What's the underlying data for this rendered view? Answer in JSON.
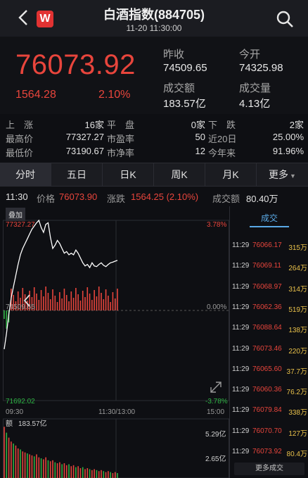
{
  "header": {
    "title": "白酒指数(884705)",
    "subtitle": "11-20 11:30:00",
    "logo_letter": "W"
  },
  "quote": {
    "price": "76073.92",
    "change": "1564.28",
    "change_pct": "2.10%",
    "prev_close_label": "昨收",
    "prev_close": "74509.65",
    "open_label": "今开",
    "open": "74325.98",
    "amount_label": "成交额",
    "amount": "183.57亿",
    "volume_label": "成交量",
    "volume": "4.13亿"
  },
  "stats": [
    [
      {
        "label": "上　涨",
        "value": "16家"
      },
      {
        "label": "平　盘",
        "value": "0家"
      },
      {
        "label": "下　跌",
        "value": "2家"
      }
    ],
    [
      {
        "label": "最高价",
        "value": "77327.27"
      },
      {
        "label": "市盈率",
        "value": "50"
      },
      {
        "label": "近20日",
        "value": "25.00%"
      }
    ],
    [
      {
        "label": "最低价",
        "value": "73190.67"
      },
      {
        "label": "市净率",
        "value": "12"
      },
      {
        "label": "今年来",
        "value": "91.96%"
      }
    ]
  ],
  "tabs": [
    "分时",
    "五日",
    "日K",
    "周K",
    "月K",
    "更多"
  ],
  "info": {
    "time": "11:30",
    "price_label": "价格",
    "price": "76073.90",
    "change_label": "涨跌",
    "change": "1564.25 (2.10%)",
    "amount_label": "成交额",
    "amount": "80.40万"
  },
  "chart": {
    "overlay_label": "叠加",
    "top_price": "77327.27",
    "top_pct": "3.78%",
    "mid_price": "74509.65",
    "mid_pct": "0.00%",
    "bottom_price": "71692.02",
    "bottom_pct": "-3.78%",
    "time_start": "09:30",
    "time_mid": "11:30/13:00",
    "time_end": "15:00",
    "volume_label": "额",
    "volume_total": "183.57亿",
    "vol_top": "5.29亿",
    "vol_mid": "2.65亿"
  },
  "chart_data": {
    "type": "line",
    "title": "白酒指数(884705)",
    "prev_close": 74509.65,
    "ylim": [
      71692.02,
      77327.27
    ],
    "x_labels": [
      "09:30",
      "11:30/13:00",
      "15:00"
    ],
    "price_series": [
      73300,
      73800,
      74400,
      74900,
      75250,
      75600,
      75950,
      76250,
      76450,
      76600,
      76750,
      76900,
      77050,
      77150,
      77250,
      77327,
      77100,
      76950,
      77200,
      77250,
      76800,
      76450,
      76550,
      76700,
      76600,
      76450,
      76300,
      76350,
      76250,
      76300,
      76250,
      76400,
      76300,
      76150,
      76000,
      75900,
      75950,
      75850,
      76000,
      75900,
      75880,
      75950,
      76000,
      75920,
      75880,
      75950,
      76000,
      76020,
      76050,
      76073.9
    ],
    "volume_series": [
      5.2,
      4.6,
      4.1,
      3.7,
      3.5,
      3.3,
      3.0,
      2.9,
      2.7,
      2.6,
      2.5,
      2.4,
      2.3,
      2.2,
      2.4,
      2.1,
      2.0,
      1.9,
      2.1,
      1.8,
      1.7,
      1.8,
      1.6,
      1.5,
      1.6,
      1.4,
      1.5,
      1.3,
      1.4,
      1.2,
      1.3,
      1.1,
      1.2,
      1.0,
      1.1,
      0.9,
      1.0,
      0.9,
      0.8,
      0.9,
      0.8,
      0.7,
      0.8,
      0.7,
      0.6,
      0.7,
      0.6,
      0.5,
      0.6,
      0.5
    ],
    "volume_ylim": [
      0,
      5.29
    ]
  },
  "trades": {
    "tab_label": "成交",
    "more_label": "更多成交",
    "rows": [
      {
        "time": "11:29",
        "price": "76066.17",
        "vol": "315万"
      },
      {
        "time": "11:29",
        "price": "76069.11",
        "vol": "264万"
      },
      {
        "time": "11:29",
        "price": "76068.97",
        "vol": "314万"
      },
      {
        "time": "11:29",
        "price": "76062.36",
        "vol": "519万"
      },
      {
        "time": "11:29",
        "price": "76088.64",
        "vol": "138万"
      },
      {
        "time": "11:29",
        "price": "76073.46",
        "vol": "220万"
      },
      {
        "time": "11:29",
        "price": "76065.60",
        "vol": "37.7万"
      },
      {
        "time": "11:29",
        "price": "76060.36",
        "vol": "76.2万"
      },
      {
        "time": "11:29",
        "price": "76079.84",
        "vol": "338万"
      },
      {
        "time": "11:29",
        "price": "76070.70",
        "vol": "127万"
      },
      {
        "time": "11:29",
        "price": "76073.92",
        "vol": "80.4万"
      }
    ]
  },
  "colors": {
    "up": "#e8453c",
    "down": "#2fb344",
    "accent": "#5aa9e6",
    "line": "#ffffff"
  }
}
